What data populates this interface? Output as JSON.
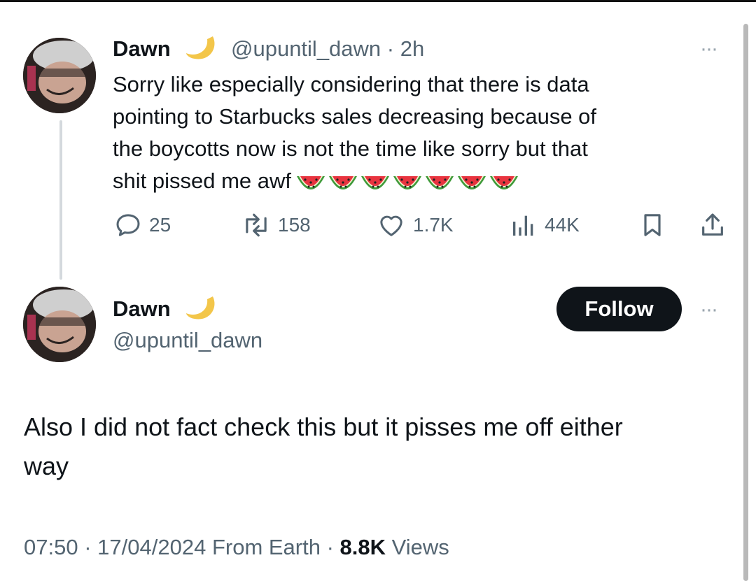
{
  "colors": {
    "text": "#0f1419",
    "secondary": "#536471",
    "button_bg": "#0f1419",
    "button_text": "#ffffff"
  },
  "reply": {
    "display_name": "Dawn",
    "handle": "@upuntil_dawn",
    "separator": "·",
    "time": "2h",
    "text_lines": [
      "Sorry like especially considering that there is data",
      "pointing to Starbucks sales decreasing because of",
      "the boycotts now is not the time like sorry but that",
      "shit pissed me awf"
    ],
    "emoji": "watermelon-slice",
    "emoji_count": 7,
    "more_label": "···",
    "actions": {
      "reply_count": "25",
      "repost_count": "158",
      "like_count": "1.7K",
      "views_count": "44K"
    }
  },
  "main_tweet": {
    "display_name": "Dawn",
    "handle": "@upuntil_dawn",
    "follow_label": "Follow",
    "more_label": "···",
    "text_lines": [
      "Also I did not fact check this but it pisses me off either",
      "way"
    ],
    "time": "07:50",
    "date": "17/04/2024",
    "source": "From Earth",
    "views_count": "8.8K",
    "views_label": "Views",
    "separator": "·"
  }
}
